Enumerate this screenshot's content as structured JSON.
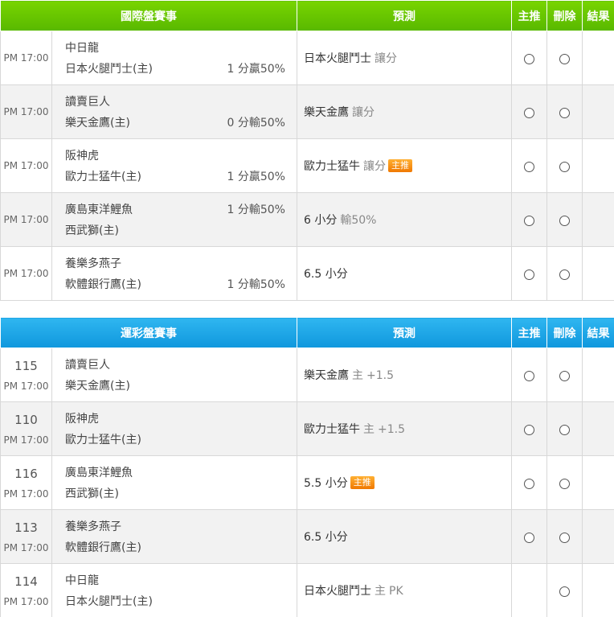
{
  "tables": [
    {
      "theme": "green",
      "headers": {
        "event": "國際盤賽事",
        "predict": "預測",
        "main": "主推",
        "delete": "刪除",
        "result": "結果"
      },
      "rows": [
        {
          "num": "",
          "time": "PM 17:00",
          "team1": "中日龍",
          "team2": "日本火腿鬥士(主)",
          "odds1": "",
          "odds2": "1 分贏50%",
          "pick": "日本火腿鬥士",
          "type": "讓分",
          "odd": "",
          "badge": "",
          "has_main_radio": true
        },
        {
          "num": "",
          "time": "PM 17:00",
          "team1": "讀賣巨人",
          "team2": "樂天金鷹(主)",
          "odds1": "",
          "odds2": "0 分輸50%",
          "pick": "樂天金鷹",
          "type": "讓分",
          "odd": "",
          "badge": "",
          "has_main_radio": true
        },
        {
          "num": "",
          "time": "PM 17:00",
          "team1": "阪神虎",
          "team2": "歐力士猛牛(主)",
          "odds1": "",
          "odds2": "1 分贏50%",
          "pick": "歐力士猛牛",
          "type": "讓分",
          "odd": "",
          "badge": "主推",
          "has_main_radio": true
        },
        {
          "num": "",
          "time": "PM 17:00",
          "team1": "廣島東洋鯉魚",
          "team2": "西武獅(主)",
          "odds1": "1 分輸50%",
          "odds2": "",
          "pick": "6 小分",
          "type": "",
          "odd": "輸50%",
          "badge": "",
          "has_main_radio": true
        },
        {
          "num": "",
          "time": "PM 17:00",
          "team1": "養樂多燕子",
          "team2": "軟體銀行鷹(主)",
          "odds1": "",
          "odds2": "1 分輸50%",
          "pick": "6.5 小分",
          "type": "",
          "odd": "",
          "badge": "",
          "has_main_radio": true
        }
      ]
    },
    {
      "theme": "blue",
      "headers": {
        "event": "運彩盤賽事",
        "predict": "預測",
        "main": "主推",
        "delete": "刪除",
        "result": "結果"
      },
      "rows": [
        {
          "num": "115",
          "time": "PM 17:00",
          "team1": "讀賣巨人",
          "team2": "樂天金鷹(主)",
          "odds1": "",
          "odds2": "",
          "pick": "樂天金鷹",
          "type": "主",
          "odd": "+1.5",
          "badge": "",
          "has_main_radio": true
        },
        {
          "num": "110",
          "time": "PM 17:00",
          "team1": "阪神虎",
          "team2": "歐力士猛牛(主)",
          "odds1": "",
          "odds2": "",
          "pick": "歐力士猛牛",
          "type": "主",
          "odd": "+1.5",
          "badge": "",
          "has_main_radio": true
        },
        {
          "num": "116",
          "time": "PM 17:00",
          "team1": "廣島東洋鯉魚",
          "team2": "西武獅(主)",
          "odds1": "",
          "odds2": "",
          "pick": "5.5 小分",
          "type": "",
          "odd": "",
          "badge": "主推",
          "has_main_radio": true
        },
        {
          "num": "113",
          "time": "PM 17:00",
          "team1": "養樂多燕子",
          "team2": "軟體銀行鷹(主)",
          "odds1": "",
          "odds2": "",
          "pick": "6.5 小分",
          "type": "",
          "odd": "",
          "badge": "",
          "has_main_radio": true
        },
        {
          "num": "114",
          "time": "PM 17:00",
          "team1": "中日龍",
          "team2": "日本火腿鬥士(主)",
          "odds1": "",
          "odds2": "",
          "pick": "日本火腿鬥士",
          "type": "主",
          "odd": "PK",
          "badge": "",
          "has_main_radio": false
        }
      ]
    }
  ],
  "icons": {
    "radio": "radio-circle-icon"
  },
  "colors": {
    "green_header": "#5cbd00",
    "blue_header": "#139be0",
    "badge": "#f28a00"
  }
}
